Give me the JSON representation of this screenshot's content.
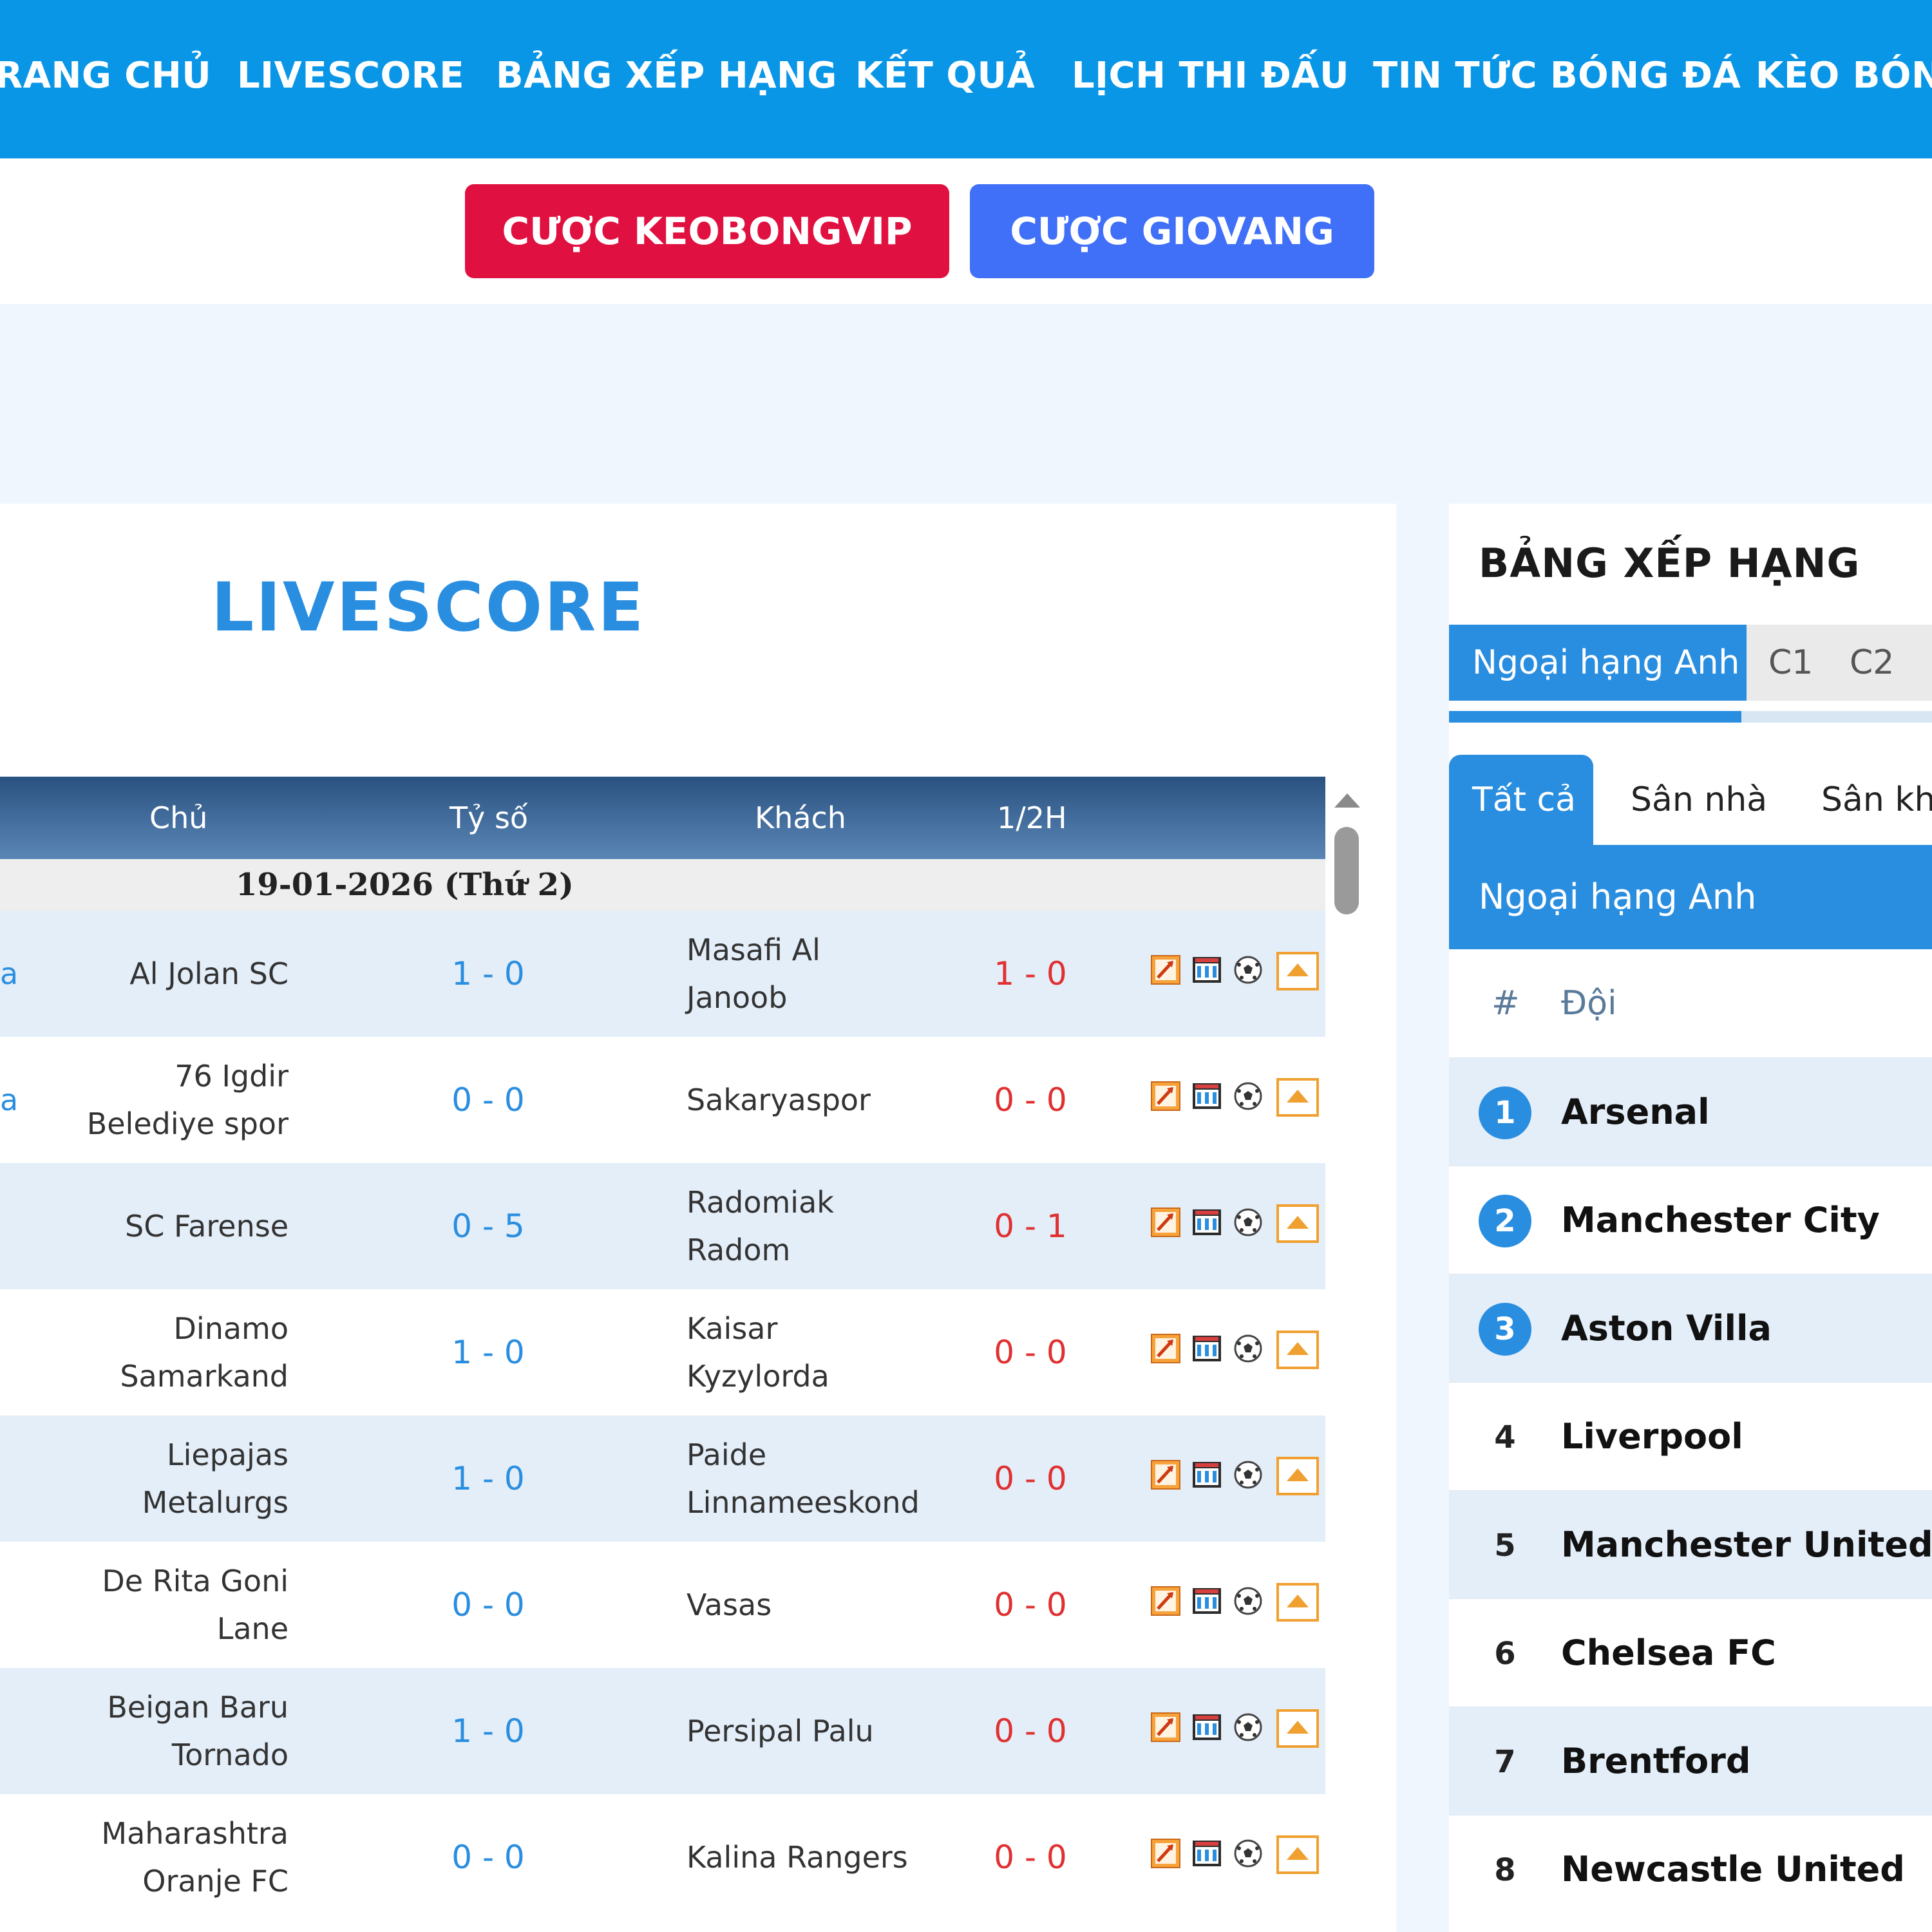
{
  "nav": {
    "items": [
      "RANG CHỦ",
      "LIVESCORE",
      "BẢNG XẾP HẠNG",
      "KẾT QUẢ",
      "LỊCH THI ĐẤU",
      "TIN TỨC BÓNG ĐÁ",
      "KÈO BÓNG"
    ]
  },
  "promo": {
    "red_label": "CƯỢC KEOBONGVIP",
    "blue_label": "CƯỢC GIOVANG"
  },
  "livescore": {
    "title": "LIVESCORE",
    "columns": {
      "home": "Chủ",
      "score": "Tỷ số",
      "away": "Khách",
      "half": "1/2H"
    },
    "date": "19-01-2026 (Thứ 2)",
    "matches": [
      {
        "edge": "a",
        "home_l1": "Al Jolan SC",
        "home_l2": "",
        "score": "1 - 0",
        "away_l1": "Masafi Al",
        "away_l2": "Janoob",
        "half": "1 - 0"
      },
      {
        "edge": "a",
        "home_l1": "76 Igdir",
        "home_l2": "Belediye spor",
        "score": "0 - 0",
        "away_l1": "Sakaryaspor",
        "away_l2": "",
        "half": "0 - 0"
      },
      {
        "edge": "",
        "home_l1": "SC Farense",
        "home_l2": "",
        "score": "0 - 5",
        "away_l1": "Radomiak",
        "away_l2": "Radom",
        "half": "0 - 1"
      },
      {
        "edge": "",
        "home_l1": "Dinamo",
        "home_l2": "Samarkand",
        "score": "1 - 0",
        "away_l1": "Kaisar",
        "away_l2": "Kyzylorda",
        "half": "0 - 0"
      },
      {
        "edge": "",
        "home_l1": "Liepajas",
        "home_l2": "Metalurgs",
        "score": "1 - 0",
        "away_l1": "Paide",
        "away_l2": "Linnameeskond",
        "half": "0 - 0"
      },
      {
        "edge": "",
        "home_l1": "De Rita Goni",
        "home_l2": "Lane",
        "score": "0 - 0",
        "away_l1": "Vasas",
        "away_l2": "",
        "half": "0 - 0"
      },
      {
        "edge": "",
        "home_l1": "Beigan Baru",
        "home_l2": "Tornado",
        "score": "1 - 0",
        "away_l1": "Persipal Palu",
        "away_l2": "",
        "half": "0 - 0"
      },
      {
        "edge": "",
        "home_l1": "Maharashtra",
        "home_l2": "Oranje FC",
        "score": "0 - 0",
        "away_l1": "Kalina Rangers",
        "away_l2": "",
        "half": "0 - 0"
      }
    ]
  },
  "standings": {
    "title": "BẢNG XẾP HẠNG",
    "league_tabs": [
      "Ngoại hạng Anh",
      "C1",
      "C2"
    ],
    "venue_tabs": [
      "Tất cả",
      "Sân nhà",
      "Sân kha"
    ],
    "league_name": "Ngoại hạng Anh",
    "head": {
      "num": "#",
      "team": "Đội"
    },
    "teams": [
      {
        "rank": "1",
        "name": "Arsenal"
      },
      {
        "rank": "2",
        "name": "Manchester City"
      },
      {
        "rank": "3",
        "name": "Aston Villa"
      },
      {
        "rank": "4",
        "name": "Liverpool"
      },
      {
        "rank": "5",
        "name": "Manchester United"
      },
      {
        "rank": "6",
        "name": "Chelsea FC"
      },
      {
        "rank": "7",
        "name": "Brentford"
      },
      {
        "rank": "8",
        "name": "Newcastle United"
      }
    ]
  },
  "colors": {
    "nav_bg": "#0a96e6",
    "accent": "#2a8ee0",
    "promo_red": "#e01040",
    "promo_blue": "#4070f8",
    "halftime_red": "#e03030"
  },
  "icons": [
    "odds-chart-icon",
    "stats-table-icon",
    "soccer-ball-icon",
    "expand-up-icon"
  ]
}
